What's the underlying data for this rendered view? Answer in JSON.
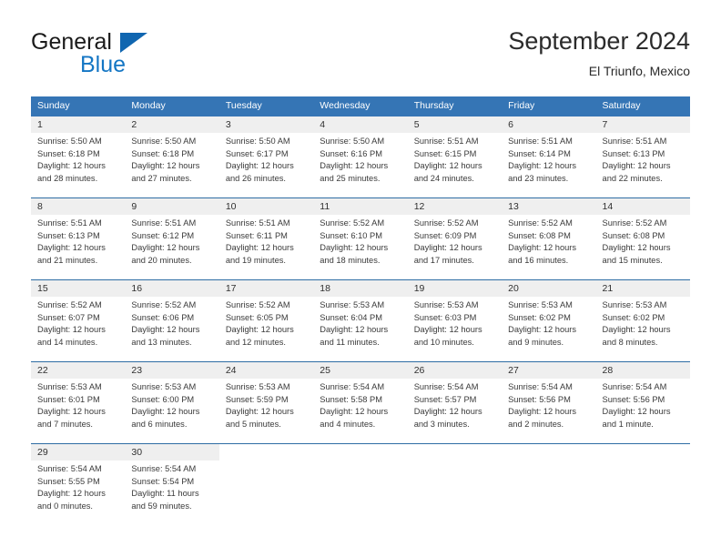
{
  "brand": {
    "name_part1": "General",
    "name_part2": "Blue"
  },
  "header": {
    "title": "September 2024",
    "location": "El Triunfo, Mexico"
  },
  "calendar": {
    "weekday_headers": [
      "Sunday",
      "Monday",
      "Tuesday",
      "Wednesday",
      "Thursday",
      "Friday",
      "Saturday"
    ],
    "colors": {
      "header_blue": "#3575b5",
      "row_divider_blue": "#2e6da4",
      "daynum_band": "#efefef",
      "brand_blue": "#1476c4"
    },
    "weeks": [
      [
        {
          "day": "1",
          "sunrise": "Sunrise: 5:50 AM",
          "sunset": "Sunset: 6:18 PM",
          "daylight_line1": "Daylight: 12 hours",
          "daylight_line2": "and 28 minutes."
        },
        {
          "day": "2",
          "sunrise": "Sunrise: 5:50 AM",
          "sunset": "Sunset: 6:18 PM",
          "daylight_line1": "Daylight: 12 hours",
          "daylight_line2": "and 27 minutes."
        },
        {
          "day": "3",
          "sunrise": "Sunrise: 5:50 AM",
          "sunset": "Sunset: 6:17 PM",
          "daylight_line1": "Daylight: 12 hours",
          "daylight_line2": "and 26 minutes."
        },
        {
          "day": "4",
          "sunrise": "Sunrise: 5:50 AM",
          "sunset": "Sunset: 6:16 PM",
          "daylight_line1": "Daylight: 12 hours",
          "daylight_line2": "and 25 minutes."
        },
        {
          "day": "5",
          "sunrise": "Sunrise: 5:51 AM",
          "sunset": "Sunset: 6:15 PM",
          "daylight_line1": "Daylight: 12 hours",
          "daylight_line2": "and 24 minutes."
        },
        {
          "day": "6",
          "sunrise": "Sunrise: 5:51 AM",
          "sunset": "Sunset: 6:14 PM",
          "daylight_line1": "Daylight: 12 hours",
          "daylight_line2": "and 23 minutes."
        },
        {
          "day": "7",
          "sunrise": "Sunrise: 5:51 AM",
          "sunset": "Sunset: 6:13 PM",
          "daylight_line1": "Daylight: 12 hours",
          "daylight_line2": "and 22 minutes."
        }
      ],
      [
        {
          "day": "8",
          "sunrise": "Sunrise: 5:51 AM",
          "sunset": "Sunset: 6:13 PM",
          "daylight_line1": "Daylight: 12 hours",
          "daylight_line2": "and 21 minutes."
        },
        {
          "day": "9",
          "sunrise": "Sunrise: 5:51 AM",
          "sunset": "Sunset: 6:12 PM",
          "daylight_line1": "Daylight: 12 hours",
          "daylight_line2": "and 20 minutes."
        },
        {
          "day": "10",
          "sunrise": "Sunrise: 5:51 AM",
          "sunset": "Sunset: 6:11 PM",
          "daylight_line1": "Daylight: 12 hours",
          "daylight_line2": "and 19 minutes."
        },
        {
          "day": "11",
          "sunrise": "Sunrise: 5:52 AM",
          "sunset": "Sunset: 6:10 PM",
          "daylight_line1": "Daylight: 12 hours",
          "daylight_line2": "and 18 minutes."
        },
        {
          "day": "12",
          "sunrise": "Sunrise: 5:52 AM",
          "sunset": "Sunset: 6:09 PM",
          "daylight_line1": "Daylight: 12 hours",
          "daylight_line2": "and 17 minutes."
        },
        {
          "day": "13",
          "sunrise": "Sunrise: 5:52 AM",
          "sunset": "Sunset: 6:08 PM",
          "daylight_line1": "Daylight: 12 hours",
          "daylight_line2": "and 16 minutes."
        },
        {
          "day": "14",
          "sunrise": "Sunrise: 5:52 AM",
          "sunset": "Sunset: 6:08 PM",
          "daylight_line1": "Daylight: 12 hours",
          "daylight_line2": "and 15 minutes."
        }
      ],
      [
        {
          "day": "15",
          "sunrise": "Sunrise: 5:52 AM",
          "sunset": "Sunset: 6:07 PM",
          "daylight_line1": "Daylight: 12 hours",
          "daylight_line2": "and 14 minutes."
        },
        {
          "day": "16",
          "sunrise": "Sunrise: 5:52 AM",
          "sunset": "Sunset: 6:06 PM",
          "daylight_line1": "Daylight: 12 hours",
          "daylight_line2": "and 13 minutes."
        },
        {
          "day": "17",
          "sunrise": "Sunrise: 5:52 AM",
          "sunset": "Sunset: 6:05 PM",
          "daylight_line1": "Daylight: 12 hours",
          "daylight_line2": "and 12 minutes."
        },
        {
          "day": "18",
          "sunrise": "Sunrise: 5:53 AM",
          "sunset": "Sunset: 6:04 PM",
          "daylight_line1": "Daylight: 12 hours",
          "daylight_line2": "and 11 minutes."
        },
        {
          "day": "19",
          "sunrise": "Sunrise: 5:53 AM",
          "sunset": "Sunset: 6:03 PM",
          "daylight_line1": "Daylight: 12 hours",
          "daylight_line2": "and 10 minutes."
        },
        {
          "day": "20",
          "sunrise": "Sunrise: 5:53 AM",
          "sunset": "Sunset: 6:02 PM",
          "daylight_line1": "Daylight: 12 hours",
          "daylight_line2": "and 9 minutes."
        },
        {
          "day": "21",
          "sunrise": "Sunrise: 5:53 AM",
          "sunset": "Sunset: 6:02 PM",
          "daylight_line1": "Daylight: 12 hours",
          "daylight_line2": "and 8 minutes."
        }
      ],
      [
        {
          "day": "22",
          "sunrise": "Sunrise: 5:53 AM",
          "sunset": "Sunset: 6:01 PM",
          "daylight_line1": "Daylight: 12 hours",
          "daylight_line2": "and 7 minutes."
        },
        {
          "day": "23",
          "sunrise": "Sunrise: 5:53 AM",
          "sunset": "Sunset: 6:00 PM",
          "daylight_line1": "Daylight: 12 hours",
          "daylight_line2": "and 6 minutes."
        },
        {
          "day": "24",
          "sunrise": "Sunrise: 5:53 AM",
          "sunset": "Sunset: 5:59 PM",
          "daylight_line1": "Daylight: 12 hours",
          "daylight_line2": "and 5 minutes."
        },
        {
          "day": "25",
          "sunrise": "Sunrise: 5:54 AM",
          "sunset": "Sunset: 5:58 PM",
          "daylight_line1": "Daylight: 12 hours",
          "daylight_line2": "and 4 minutes."
        },
        {
          "day": "26",
          "sunrise": "Sunrise: 5:54 AM",
          "sunset": "Sunset: 5:57 PM",
          "daylight_line1": "Daylight: 12 hours",
          "daylight_line2": "and 3 minutes."
        },
        {
          "day": "27",
          "sunrise": "Sunrise: 5:54 AM",
          "sunset": "Sunset: 5:56 PM",
          "daylight_line1": "Daylight: 12 hours",
          "daylight_line2": "and 2 minutes."
        },
        {
          "day": "28",
          "sunrise": "Sunrise: 5:54 AM",
          "sunset": "Sunset: 5:56 PM",
          "daylight_line1": "Daylight: 12 hours",
          "daylight_line2": "and 1 minute."
        }
      ],
      [
        {
          "day": "29",
          "sunrise": "Sunrise: 5:54 AM",
          "sunset": "Sunset: 5:55 PM",
          "daylight_line1": "Daylight: 12 hours",
          "daylight_line2": "and 0 minutes."
        },
        {
          "day": "30",
          "sunrise": "Sunrise: 5:54 AM",
          "sunset": "Sunset: 5:54 PM",
          "daylight_line1": "Daylight: 11 hours",
          "daylight_line2": "and 59 minutes."
        },
        {
          "day": "",
          "sunrise": "",
          "sunset": "",
          "daylight_line1": "",
          "daylight_line2": ""
        },
        {
          "day": "",
          "sunrise": "",
          "sunset": "",
          "daylight_line1": "",
          "daylight_line2": ""
        },
        {
          "day": "",
          "sunrise": "",
          "sunset": "",
          "daylight_line1": "",
          "daylight_line2": ""
        },
        {
          "day": "",
          "sunrise": "",
          "sunset": "",
          "daylight_line1": "",
          "daylight_line2": ""
        },
        {
          "day": "",
          "sunrise": "",
          "sunset": "",
          "daylight_line1": "",
          "daylight_line2": ""
        }
      ]
    ]
  }
}
